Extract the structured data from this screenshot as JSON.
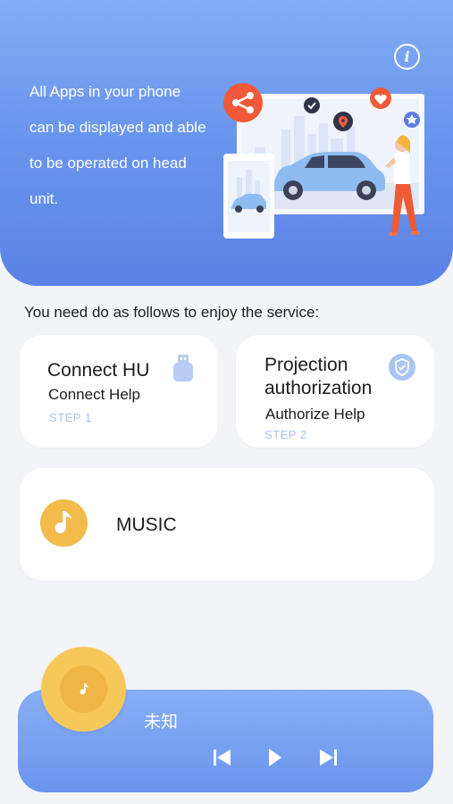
{
  "hero": {
    "description": "All Apps in your phone can be displayed and able to be operated on head unit.",
    "info_icon": "info-icon",
    "illustration_icons": [
      "share-icon",
      "check-icon",
      "location-pin-icon",
      "heart-icon",
      "star-icon"
    ]
  },
  "instructions": "You need do as follows to enjoy the service:",
  "steps": [
    {
      "title": "Connect HU",
      "help": "Connect Help",
      "step": "STEP 1",
      "icon": "usb-icon"
    },
    {
      "title": "Projection authorization",
      "help": "Authorize Help",
      "step": "STEP 2",
      "icon": "shield-check-icon"
    }
  ],
  "music": {
    "label": "MUSIC",
    "icon": "music-note-icon"
  },
  "player": {
    "track_title": "未知",
    "controls": [
      "previous-icon",
      "play-icon",
      "next-icon"
    ]
  },
  "colors": {
    "hero_top": "#83adf4",
    "hero_bottom": "#5b83e6",
    "accent_orange": "#f05a3a",
    "music_gold": "#f2bb4b",
    "step_label": "#a9c3f3",
    "background": "#f2f4f7"
  }
}
